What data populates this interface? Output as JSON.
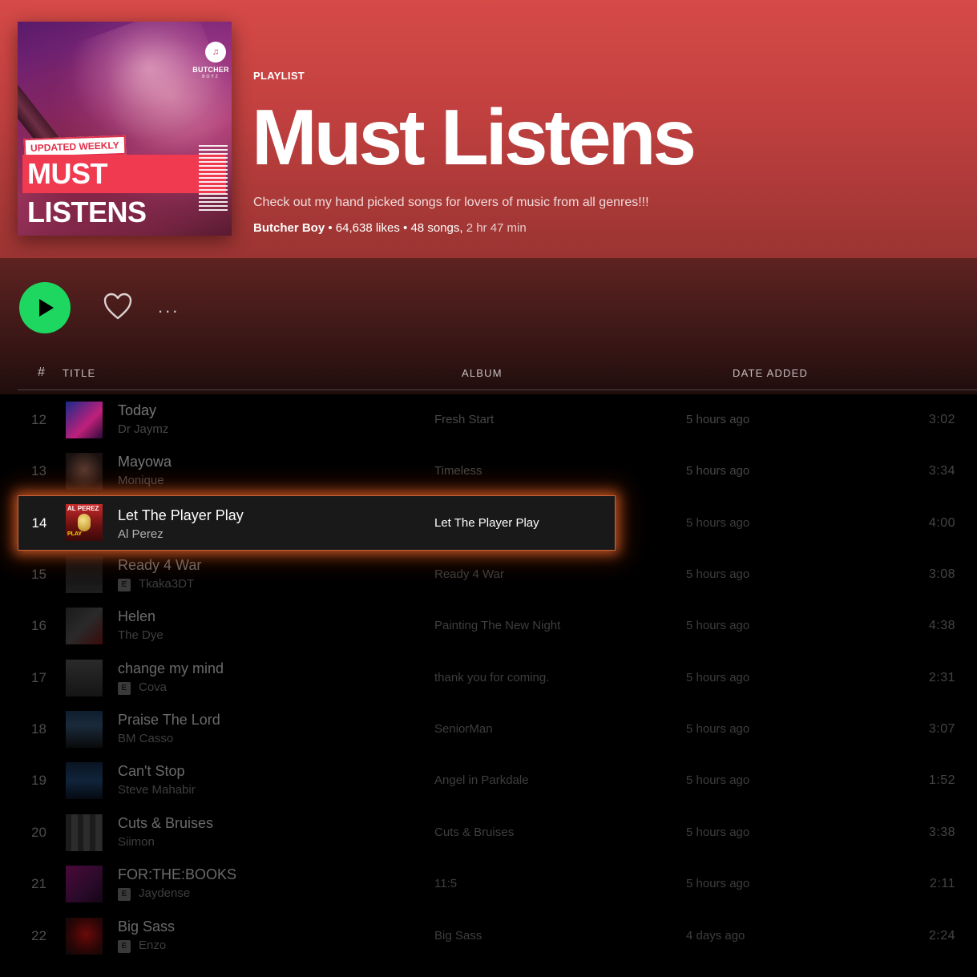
{
  "cover": {
    "brand": "BUTCHER",
    "brand_sub": "BOYZ",
    "badge": "UPDATED WEEKLY",
    "headline": "MUST LISTENS"
  },
  "header": {
    "type_label": "PLAYLIST",
    "title": "Must Listens",
    "description": "Check out my hand picked songs for lovers of music from all genres!!!",
    "owner": "Butcher Boy",
    "likes": "64,638 likes",
    "songs": "48 songs,",
    "duration": "2 hr 47 min",
    "separator": "•"
  },
  "actions": {
    "more_label": "..."
  },
  "columns": {
    "number": "#",
    "title": "TITLE",
    "album": "ALBUM",
    "date_added": "DATE ADDED"
  },
  "tracks": [
    {
      "num": "12",
      "title": "Today",
      "artist": "Dr Jaymz",
      "explicit": false,
      "album": "Fresh Start",
      "date": "5 hours ago",
      "duration": "3:02"
    },
    {
      "num": "13",
      "title": "Mayowa",
      "artist": "Monique",
      "explicit": false,
      "album": "Timeless",
      "date": "5 hours ago",
      "duration": "3:34"
    },
    {
      "num": "14",
      "title": "Let The Player Play",
      "artist": "Al Perez",
      "explicit": false,
      "album": "Let The Player Play",
      "date": "5 hours ago",
      "duration": "4:00",
      "cover_text_top": "AL PEREZ",
      "cover_text_bottom": "PLAY"
    },
    {
      "num": "15",
      "title": "Ready 4 War",
      "artist": "Tkaka3DT",
      "explicit": true,
      "album": "Ready 4 War",
      "date": "5 hours ago",
      "duration": "3:08"
    },
    {
      "num": "16",
      "title": "Helen",
      "artist": "The Dye",
      "explicit": false,
      "album": "Painting The New Night",
      "date": "5 hours ago",
      "duration": "4:38"
    },
    {
      "num": "17",
      "title": "change my mind",
      "artist": "Cova",
      "explicit": true,
      "album": "thank you for coming.",
      "date": "5 hours ago",
      "duration": "2:31"
    },
    {
      "num": "18",
      "title": "Praise The Lord",
      "artist": "BM Casso",
      "explicit": false,
      "album": "SeniorMan",
      "date": "5 hours ago",
      "duration": "3:07"
    },
    {
      "num": "19",
      "title": "Can't Stop",
      "artist": "Steve Mahabir",
      "explicit": false,
      "album": "Angel in Parkdale",
      "date": "5 hours ago",
      "duration": "1:52"
    },
    {
      "num": "20",
      "title": "Cuts & Bruises",
      "artist": "Siimon",
      "explicit": false,
      "album": "Cuts & Bruises",
      "date": "5 hours ago",
      "duration": "3:38"
    },
    {
      "num": "21",
      "title": "FOR:THE:BOOKS",
      "artist": "Jaydense",
      "explicit": true,
      "album": "11:5",
      "date": "5 hours ago",
      "duration": "2:11"
    },
    {
      "num": "22",
      "title": "Big Sass",
      "artist": "Enzo",
      "explicit": true,
      "album": "Big Sass",
      "date": "4 days ago",
      "duration": "2:24"
    }
  ],
  "explicit_label": "E",
  "colors": {
    "header_top": "#d64a48",
    "accent_green": "#1ed760",
    "highlight_border": "#c8643a"
  },
  "icons": {
    "play": "play-icon",
    "like": "heart-icon",
    "more": "more-icon",
    "explicit": "explicit-badge"
  }
}
